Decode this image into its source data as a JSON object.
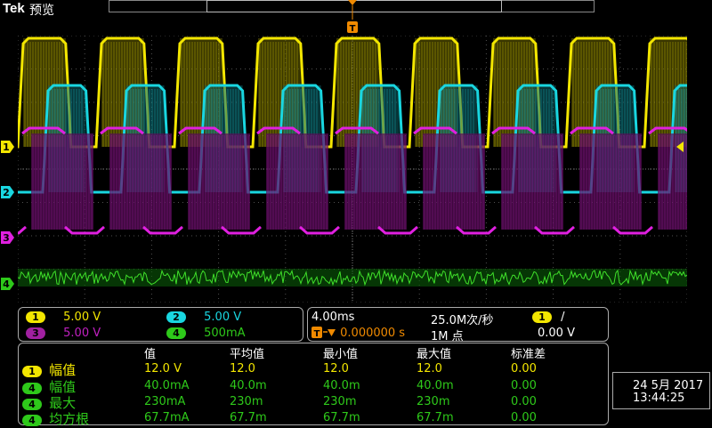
{
  "header": {
    "brand": "Tek",
    "mode": "预览",
    "trigger_mark": "T"
  },
  "colors": {
    "ch1": "#f3e600",
    "ch2": "#19d6e0",
    "ch3": "#e020e0",
    "ch4": "#2ec91a",
    "panel_border": "#aaaaaa"
  },
  "channels": [
    {
      "id": "1",
      "scale": "5.00 V"
    },
    {
      "id": "2",
      "scale": "5.00 V"
    },
    {
      "id": "3",
      "scale": "5.00 V"
    },
    {
      "id": "4",
      "scale": "500mA"
    }
  ],
  "timebase": {
    "per_div": "4.00ms",
    "sample_rate": "25.0M次/秒",
    "trigger_offset": "0.000000 s",
    "record_length": "1M 点",
    "trigger_channel": "1",
    "trigger_slope": "/",
    "trigger_level": "0.00 V"
  },
  "measurements": {
    "headers": [
      "值",
      "平均值",
      "最小值",
      "最大值",
      "标准差"
    ],
    "rows": [
      {
        "channel": "1",
        "label": "幅值",
        "values": [
          "12.0 V",
          "12.0",
          "12.0",
          "12.0",
          "0.00"
        ]
      },
      {
        "channel": "4",
        "label": "幅值",
        "values": [
          "40.0mA",
          "40.0m",
          "40.0m",
          "40.0m",
          "0.00"
        ]
      },
      {
        "channel": "4",
        "label": "最大",
        "values": [
          "230mA",
          "230m",
          "230m",
          "230m",
          "0.00"
        ]
      },
      {
        "channel": "4",
        "label": "均方根",
        "values": [
          "67.7mA",
          "67.7m",
          "67.7m",
          "67.7m",
          "0.00"
        ]
      }
    ]
  },
  "datetime": {
    "date": "24 5月 2017",
    "time": "13:44:25"
  }
}
